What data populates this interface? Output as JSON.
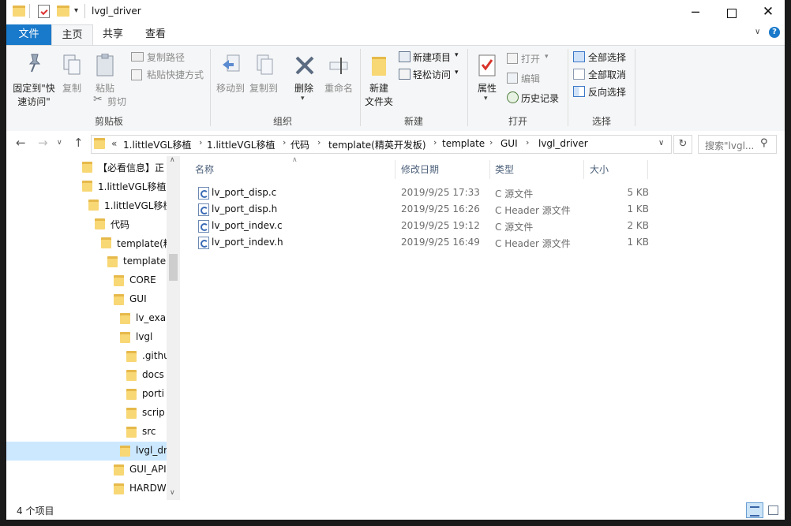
{
  "window": {
    "title": "lvgl_driver"
  },
  "tabs": {
    "file": "文件",
    "home": "主页",
    "share": "共享",
    "view": "查看"
  },
  "ribbon": {
    "clipboard": {
      "label": "剪贴板",
      "pin_line1": "固定到\"快",
      "pin_line2": "速访问\"",
      "copy": "复制",
      "paste": "粘贴",
      "copy_path": "复制路径",
      "paste_shortcut": "粘贴快捷方式",
      "cut": "剪切"
    },
    "organize": {
      "label": "组织",
      "move_to": "移动到",
      "copy_to": "复制到",
      "delete": "删除",
      "rename": "重命名"
    },
    "new": {
      "label": "新建",
      "new_folder_line1": "新建",
      "new_folder_line2": "文件夹",
      "new_item": "新建项目",
      "easy_access": "轻松访问"
    },
    "open": {
      "label": "打开",
      "properties": "属性",
      "open": "打开",
      "edit": "编辑",
      "history": "历史记录"
    },
    "select": {
      "label": "选择",
      "select_all": "全部选择",
      "select_none": "全部取消",
      "invert": "反向选择"
    }
  },
  "address": {
    "prefix": "«",
    "crumbs": [
      "1.littleVGL移植",
      "1.littleVGL移植",
      "代码",
      "template(精英开发板)",
      "template",
      "GUI",
      "lvgl_driver"
    ],
    "search_placeholder": "搜索\"lvgl..."
  },
  "tree": [
    {
      "label": "【必看信息】正",
      "indent": 96
    },
    {
      "label": "1.littleVGL移植",
      "indent": 96
    },
    {
      "label": "1.littleVGL移植",
      "indent": 104
    },
    {
      "label": "代码",
      "indent": 112
    },
    {
      "label": "template(精",
      "indent": 120
    },
    {
      "label": "template",
      "indent": 128
    },
    {
      "label": "CORE",
      "indent": 136
    },
    {
      "label": "GUI",
      "indent": 136
    },
    {
      "label": "lv_exar",
      "indent": 144
    },
    {
      "label": "lvgl",
      "indent": 144
    },
    {
      "label": ".githu",
      "indent": 152
    },
    {
      "label": "docs",
      "indent": 152
    },
    {
      "label": "porti",
      "indent": 152
    },
    {
      "label": "scrip",
      "indent": 152
    },
    {
      "label": "src",
      "indent": 152
    },
    {
      "label": "lvgl_dr",
      "indent": 144,
      "selected": true
    },
    {
      "label": "GUI_API",
      "indent": 136
    },
    {
      "label": "HARDW",
      "indent": 136
    }
  ],
  "list": {
    "columns": {
      "name": "名称",
      "date": "修改日期",
      "type": "类型",
      "size": "大小"
    },
    "rows": [
      {
        "name": "lv_port_disp.c",
        "date": "2019/9/25 17:33",
        "type": "C 源文件",
        "size": "5 KB"
      },
      {
        "name": "lv_port_disp.h",
        "date": "2019/9/25 16:26",
        "type": "C Header 源文件",
        "size": "1 KB"
      },
      {
        "name": "lv_port_indev.c",
        "date": "2019/9/25 19:12",
        "type": "C 源文件",
        "size": "2 KB"
      },
      {
        "name": "lv_port_indev.h",
        "date": "2019/9/25 16:49",
        "type": "C Header 源文件",
        "size": "1 KB"
      }
    ]
  },
  "status": {
    "count": "4 个项目"
  }
}
